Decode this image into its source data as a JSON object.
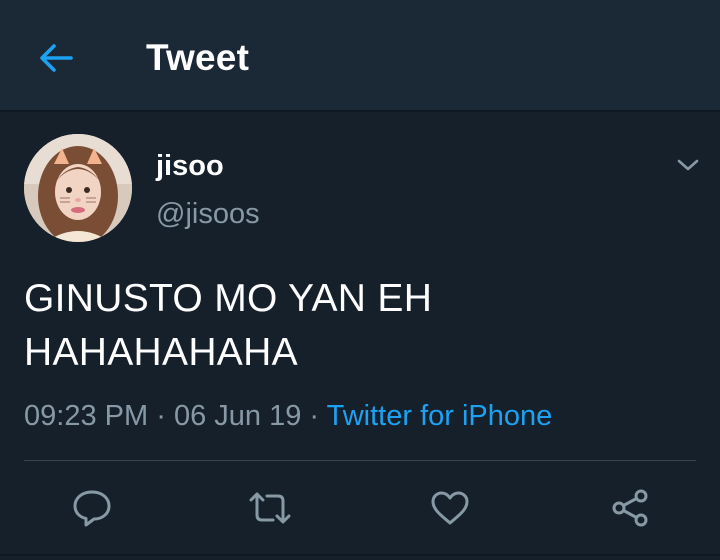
{
  "header": {
    "title": "Tweet",
    "back_icon": "arrow-left-icon"
  },
  "tweet": {
    "author": {
      "display_name": "jisoo",
      "handle": "@jisoos",
      "avatar": "profile-photo"
    },
    "text_lines": [
      "GINUSTO MO YAN EH",
      "HAHAHAHAHA"
    ],
    "time": "09:23 PM",
    "separator": "·",
    "date": "06 Jun 19",
    "source": "Twitter for iPhone",
    "menu_icon": "chevron-down-icon",
    "actions": [
      {
        "name": "reply",
        "icon": "reply-icon"
      },
      {
        "name": "retweet",
        "icon": "retweet-icon"
      },
      {
        "name": "like",
        "icon": "heart-icon"
      },
      {
        "name": "share",
        "icon": "share-icon"
      }
    ]
  },
  "colors": {
    "background": "#15202b",
    "header_background": "#1b2836",
    "accent": "#1da1f2",
    "secondary_text": "#8899a6",
    "divider": "#38444d"
  }
}
